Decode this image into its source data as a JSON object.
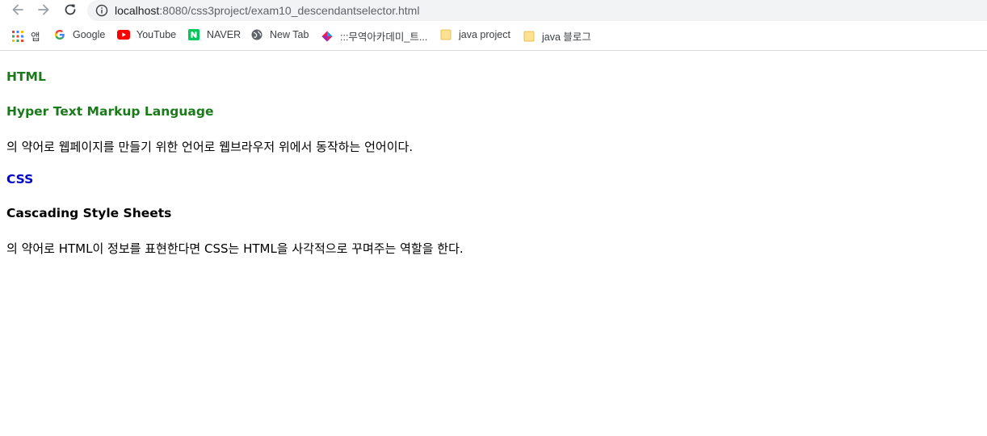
{
  "browser": {
    "url_host": "localhost",
    "url_path": ":8080/css3project/exam10_descendantselector.html",
    "bookmarks": [
      {
        "label": "앱",
        "icon": "apps-grid-icon"
      },
      {
        "label": "Google",
        "icon": "google-icon"
      },
      {
        "label": "YouTube",
        "icon": "youtube-icon"
      },
      {
        "label": "NAVER",
        "icon": "naver-icon"
      },
      {
        "label": "New Tab",
        "icon": "globe-icon"
      },
      {
        "label": ":::무역아카데미_트...",
        "icon": "diamond-logo-icon"
      },
      {
        "label": "java project",
        "icon": "folder-icon"
      },
      {
        "label": "java 블로그",
        "icon": "folder-icon"
      }
    ]
  },
  "page": {
    "html_heading": "HTML",
    "html_full": "Hyper Text Markup Language",
    "html_desc": "의 약어로 웹페이지를 만들기 위한 언어로 웹브라우저 위에서 동작하는 언어이다.",
    "css_heading": "CSS",
    "css_full": "Cascading Style Sheets",
    "css_desc": "의 약어로 HTML이 정보를 표현한다면 CSS는 HTML을 사각적으로 꾸며주는 역할을 한다."
  },
  "colors": {
    "green": "#1a7a1a",
    "blue": "#0000cc",
    "black": "#000000"
  }
}
